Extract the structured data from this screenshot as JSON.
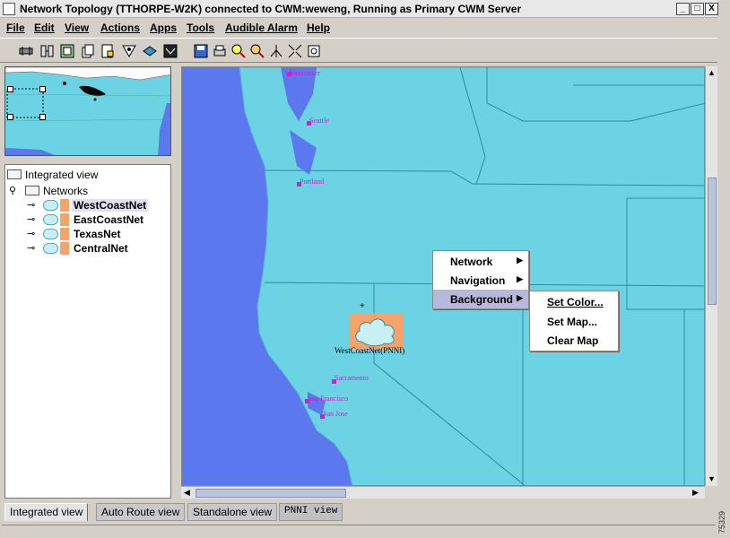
{
  "window": {
    "title": "Network Topology  (TTHORPE-W2K) connected to CWM:weweng, Running as Primary CWM Server",
    "buttons": {
      "minimize": "_",
      "maximize": "□",
      "close": "X"
    }
  },
  "menubar": {
    "items": [
      "File",
      "Edit",
      "View",
      "Actions",
      "Apps",
      "Tools",
      "Audible Alarm",
      "Help"
    ]
  },
  "toolbar": {
    "icons": [
      "network-icon",
      "equipment-icon",
      "config-icon",
      "copy-icon",
      "document-icon",
      "inspect-icon",
      "layer-icon",
      "monitor-icon",
      "save-icon",
      "print-icon",
      "zoom-in-icon",
      "zoom-out-icon",
      "hierarchy-icon",
      "shrink-icon",
      "settings-icon"
    ]
  },
  "tree": {
    "root": "Integrated view",
    "folder": "Networks",
    "networks": [
      "WestCoastNet",
      "EastCoastNet",
      "TexasNet",
      "CentralNet"
    ],
    "selected": "WestCoastNet"
  },
  "map": {
    "cities": [
      "Vancouver",
      "Seattle",
      "Portland",
      "Sacramento",
      "San Francisco",
      "San Jose"
    ],
    "node": {
      "label": "WestCoastNet(PNNI)",
      "marker": "+"
    }
  },
  "context_menu": {
    "items": [
      "Network",
      "Navigation",
      "Background"
    ],
    "active": "Background",
    "submenu_arrow": "▶",
    "submenu": [
      "Set Color...",
      "Set Map...",
      "Clear Map"
    ]
  },
  "tabs": [
    "Integrated view",
    "Auto Route view",
    "Standalone view",
    "PNNI view"
  ],
  "figure_id": "75329",
  "colors": {
    "land": "#6cd3e4",
    "water": "#5b78ee",
    "city": "#d020c8",
    "highlight": "#f4a46a"
  }
}
